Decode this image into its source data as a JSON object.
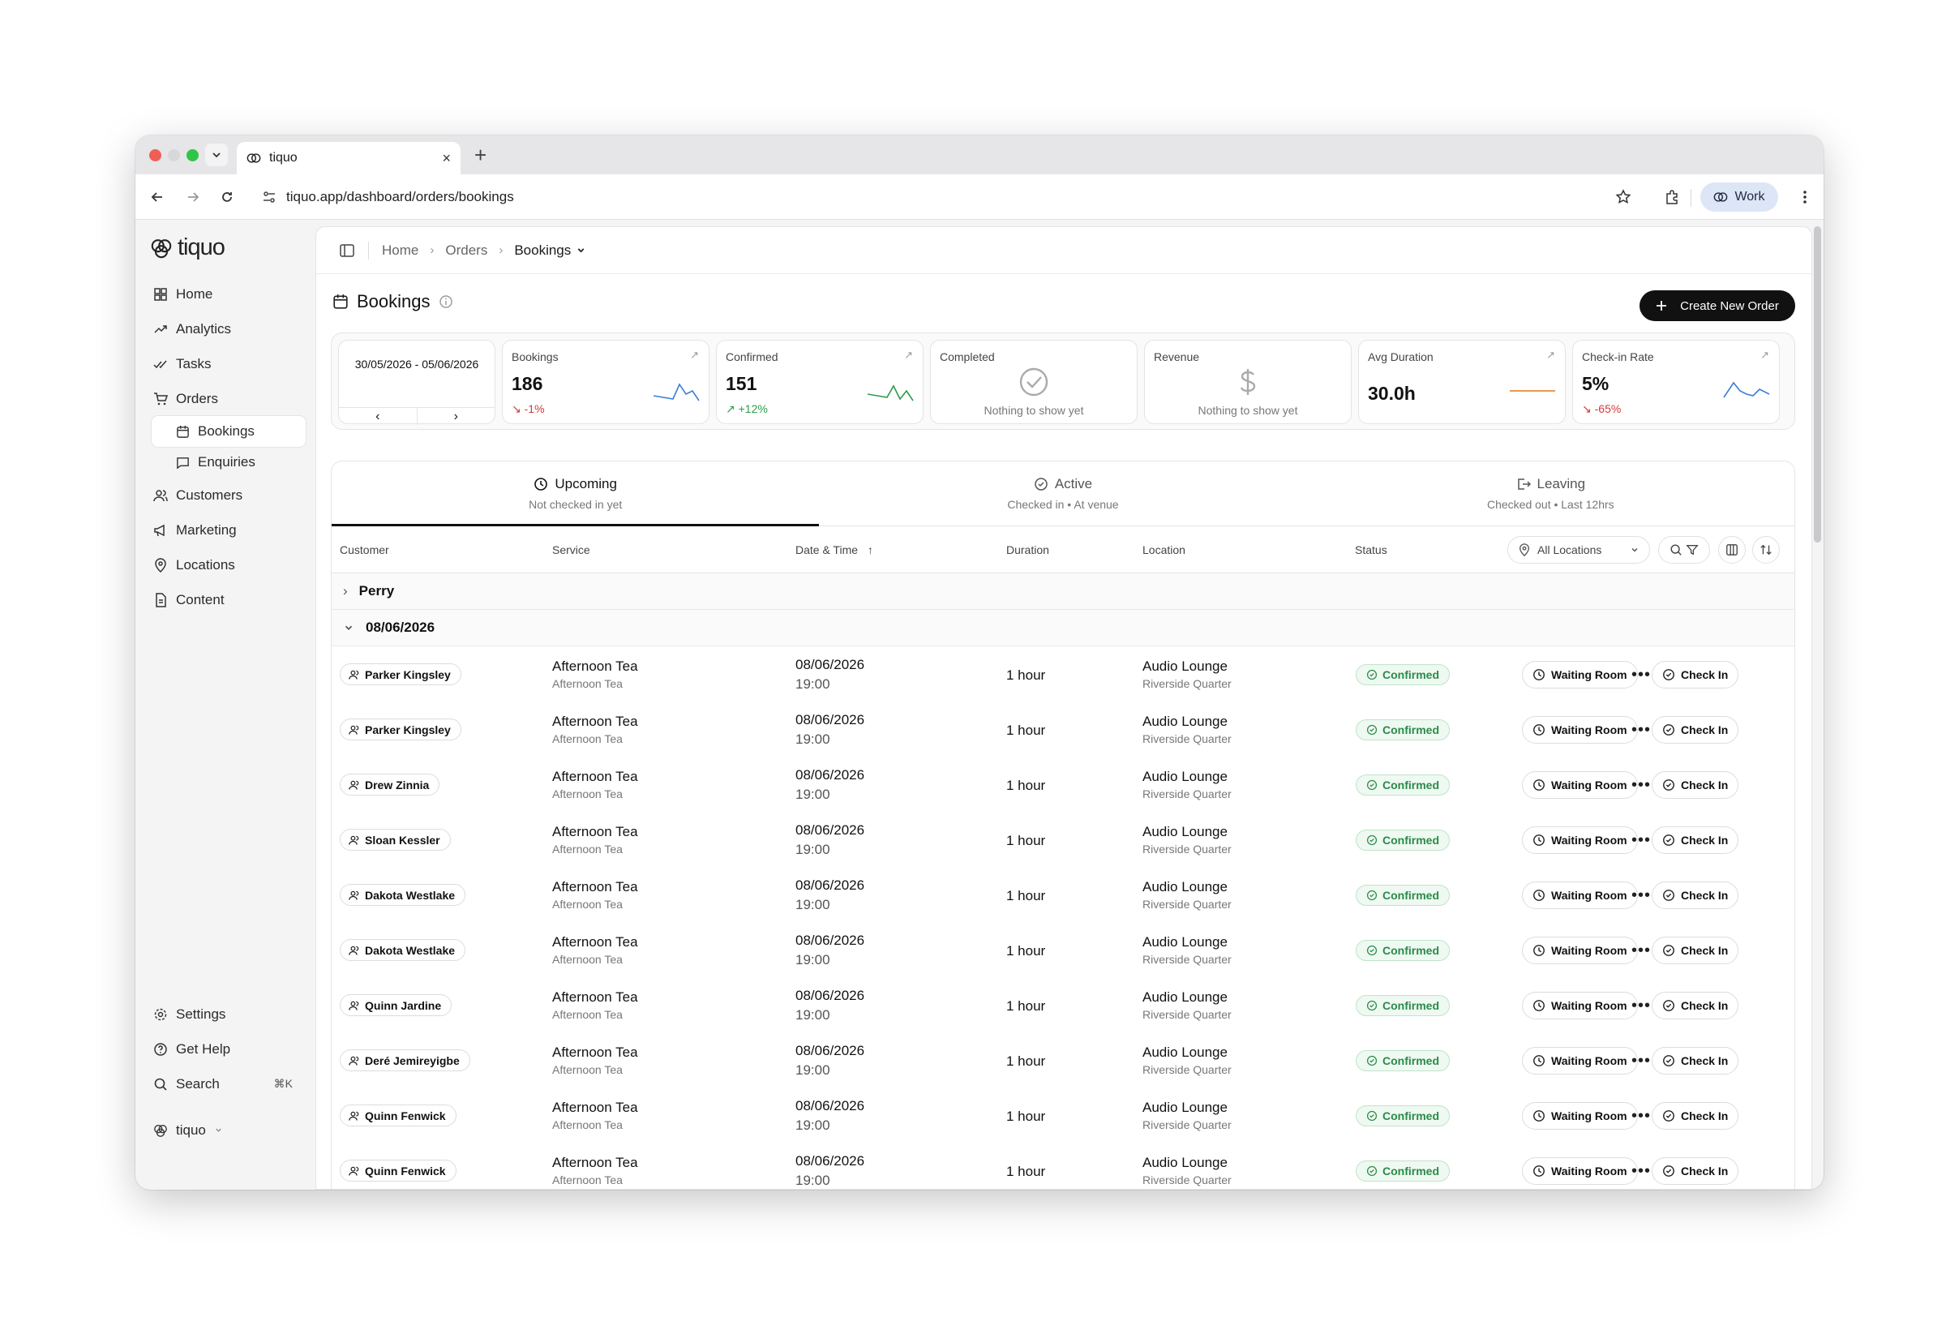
{
  "browser": {
    "tab_title": "tiquo",
    "url": "tiquo.app/dashboard/orders/bookings",
    "profile_label": "Work"
  },
  "sidebar": {
    "brand": "tiquo",
    "items": [
      {
        "label": "Home",
        "icon": "home-icon"
      },
      {
        "label": "Analytics",
        "icon": "trend-icon"
      },
      {
        "label": "Tasks",
        "icon": "check-double-icon"
      },
      {
        "label": "Orders",
        "icon": "cart-icon"
      }
    ],
    "sub_items": [
      {
        "label": "Bookings",
        "icon": "calendar-icon",
        "active": true
      },
      {
        "label": "Enquiries",
        "icon": "message-icon",
        "active": false
      }
    ],
    "items_after": [
      {
        "label": "Customers",
        "icon": "users-icon"
      },
      {
        "label": "Marketing",
        "icon": "megaphone-icon"
      },
      {
        "label": "Locations",
        "icon": "pin-icon"
      },
      {
        "label": "Content",
        "icon": "file-icon"
      }
    ],
    "bottom": {
      "settings": "Settings",
      "help": "Get Help",
      "search": "Search",
      "search_shortcut": "⌘K",
      "workspace": "tiquo"
    }
  },
  "breadcrumb": {
    "home": "Home",
    "orders": "Orders",
    "current": "Bookings"
  },
  "page": {
    "title": "Bookings",
    "create_button": "Create New Order"
  },
  "stats": {
    "date_range": "30/05/2026 - 05/06/2026",
    "bookings": {
      "label": "Bookings",
      "value": "186",
      "change": "-1%"
    },
    "confirmed": {
      "label": "Confirmed",
      "value": "151",
      "change": "+12%"
    },
    "completed": {
      "label": "Completed",
      "empty": "Nothing to show yet"
    },
    "revenue": {
      "label": "Revenue",
      "empty": "Nothing to show yet"
    },
    "avg_duration": {
      "label": "Avg Duration",
      "value": "30.0h"
    },
    "checkin_rate": {
      "label": "Check-in Rate",
      "value": "5%",
      "change": "-65%"
    },
    "colors": {
      "down": "#d23b3b",
      "up": "#2e9b4e",
      "spark_blue": "#3b7dd8",
      "spark_green": "#2e9b4e",
      "spark_orange": "#e8893a"
    }
  },
  "tabs": [
    {
      "label": "Upcoming",
      "sub": "Not checked in yet",
      "icon": "clock-icon",
      "active": true
    },
    {
      "label": "Active",
      "sub": "Checked in • At venue",
      "icon": "check-circle-icon",
      "active": false
    },
    {
      "label": "Leaving",
      "sub": "Checked out • Last 12hrs",
      "icon": "exit-icon",
      "active": false
    }
  ],
  "table": {
    "columns": [
      "Customer",
      "Service",
      "Date & Time",
      "Duration",
      "Location",
      "Status"
    ],
    "location_filter": "All Locations",
    "groups": [
      "Perry",
      "08/06/2026"
    ],
    "waiting_label": "Waiting Room",
    "checkin_label": "Check In",
    "rows": [
      {
        "customer": "Parker Kingsley",
        "service": "Afternoon Tea",
        "service_sub": "Afternoon Tea",
        "date": "08/06/2026",
        "time": "19:00",
        "duration": "1 hour",
        "location": "Audio Lounge",
        "location_sub": "Riverside Quarter",
        "status": "Confirmed"
      },
      {
        "customer": "Parker Kingsley",
        "service": "Afternoon Tea",
        "service_sub": "Afternoon Tea",
        "date": "08/06/2026",
        "time": "19:00",
        "duration": "1 hour",
        "location": "Audio Lounge",
        "location_sub": "Riverside Quarter",
        "status": "Confirmed"
      },
      {
        "customer": "Drew Zinnia",
        "service": "Afternoon Tea",
        "service_sub": "Afternoon Tea",
        "date": "08/06/2026",
        "time": "19:00",
        "duration": "1 hour",
        "location": "Audio Lounge",
        "location_sub": "Riverside Quarter",
        "status": "Confirmed"
      },
      {
        "customer": "Sloan Kessler",
        "service": "Afternoon Tea",
        "service_sub": "Afternoon Tea",
        "date": "08/06/2026",
        "time": "19:00",
        "duration": "1 hour",
        "location": "Audio Lounge",
        "location_sub": "Riverside Quarter",
        "status": "Confirmed"
      },
      {
        "customer": "Dakota Westlake",
        "service": "Afternoon Tea",
        "service_sub": "Afternoon Tea",
        "date": "08/06/2026",
        "time": "19:00",
        "duration": "1 hour",
        "location": "Audio Lounge",
        "location_sub": "Riverside Quarter",
        "status": "Confirmed"
      },
      {
        "customer": "Dakota Westlake",
        "service": "Afternoon Tea",
        "service_sub": "Afternoon Tea",
        "date": "08/06/2026",
        "time": "19:00",
        "duration": "1 hour",
        "location": "Audio Lounge",
        "location_sub": "Riverside Quarter",
        "status": "Confirmed"
      },
      {
        "customer": "Quinn Jardine",
        "service": "Afternoon Tea",
        "service_sub": "Afternoon Tea",
        "date": "08/06/2026",
        "time": "19:00",
        "duration": "1 hour",
        "location": "Audio Lounge",
        "location_sub": "Riverside Quarter",
        "status": "Confirmed"
      },
      {
        "customer": "Deré Jemireyigbe",
        "service": "Afternoon Tea",
        "service_sub": "Afternoon Tea",
        "date": "08/06/2026",
        "time": "19:00",
        "duration": "1 hour",
        "location": "Audio Lounge",
        "location_sub": "Riverside Quarter",
        "status": "Confirmed"
      },
      {
        "customer": "Quinn Fenwick",
        "service": "Afternoon Tea",
        "service_sub": "Afternoon Tea",
        "date": "08/06/2026",
        "time": "19:00",
        "duration": "1 hour",
        "location": "Audio Lounge",
        "location_sub": "Riverside Quarter",
        "status": "Confirmed"
      },
      {
        "customer": "Quinn Fenwick",
        "service": "Afternoon Tea",
        "service_sub": "Afternoon Tea",
        "date": "08/06/2026",
        "time": "19:00",
        "duration": "1 hour",
        "location": "Audio Lounge",
        "location_sub": "Riverside Quarter",
        "status": "Confirmed"
      }
    ]
  }
}
